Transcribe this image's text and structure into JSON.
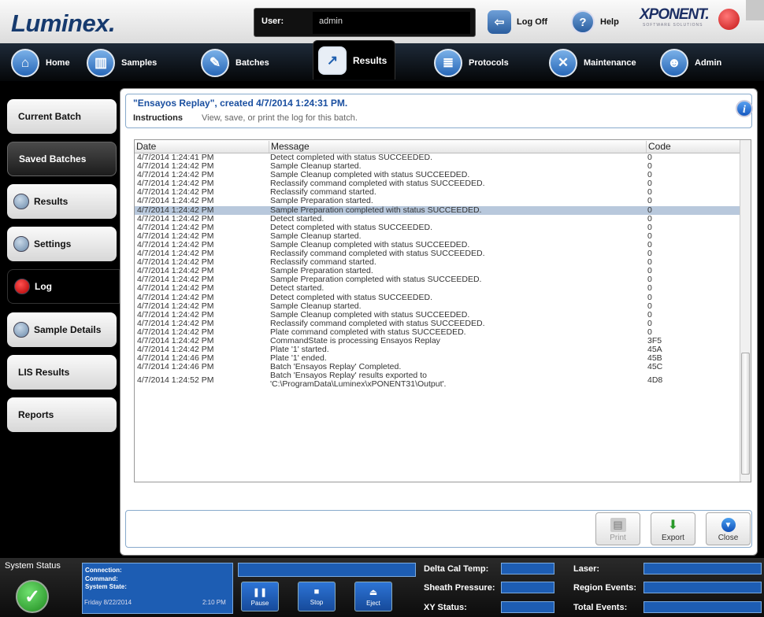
{
  "app": {
    "logo": "Luminex.",
    "brand": "XPONENT.",
    "brand_sub": "SOFTWARE SOLUTIONS"
  },
  "user": {
    "label": "User:",
    "value": "admin"
  },
  "topbar": {
    "logoff_label": "Log Off",
    "help_label": "Help"
  },
  "nav": {
    "tabs": [
      {
        "label": "Home",
        "icon": "home-icon"
      },
      {
        "label": "Samples",
        "icon": "samples-icon"
      },
      {
        "label": "Batches",
        "icon": "batches-icon"
      },
      {
        "label": "Results",
        "icon": "results-chart-icon",
        "active": true
      },
      {
        "label": "Protocols",
        "icon": "protocols-icon"
      },
      {
        "label": "Maintenance",
        "icon": "maintenance-icon"
      },
      {
        "label": "Admin",
        "icon": "admin-icon"
      }
    ]
  },
  "sidebar": {
    "items": [
      {
        "label": "Current Batch"
      },
      {
        "label": "Saved Batches"
      },
      {
        "label": "Results"
      },
      {
        "label": "Settings"
      },
      {
        "label": "Log"
      },
      {
        "label": "Sample Details"
      },
      {
        "label": "LIS Results"
      },
      {
        "label": "Reports"
      }
    ]
  },
  "header": {
    "title": "\"Ensayos Replay\", created 4/7/2014 1:24:31 PM.",
    "instructions_label": "Instructions",
    "instructions_text": "View, save, or print the log for this batch."
  },
  "log": {
    "columns": [
      "Date",
      "Message",
      "Code"
    ],
    "selected_index": 6,
    "rows": [
      [
        "4/7/2014 1:24:41 PM",
        "Detect completed with status SUCCEEDED.",
        "0"
      ],
      [
        "4/7/2014 1:24:42 PM",
        "Sample Cleanup started.",
        "0"
      ],
      [
        "4/7/2014 1:24:42 PM",
        "Sample Cleanup completed with status SUCCEEDED.",
        "0"
      ],
      [
        "4/7/2014 1:24:42 PM",
        "Reclassify command completed with status SUCCEEDED.",
        "0"
      ],
      [
        "4/7/2014 1:24:42 PM",
        "Reclassify command started.",
        "0"
      ],
      [
        "4/7/2014 1:24:42 PM",
        "Sample Preparation started.",
        "0"
      ],
      [
        "4/7/2014 1:24:42 PM",
        "Sample Preparation completed with status SUCCEEDED.",
        "0"
      ],
      [
        "4/7/2014 1:24:42 PM",
        "Detect started.",
        "0"
      ],
      [
        "4/7/2014 1:24:42 PM",
        "Detect completed with status SUCCEEDED.",
        "0"
      ],
      [
        "4/7/2014 1:24:42 PM",
        "Sample Cleanup started.",
        "0"
      ],
      [
        "4/7/2014 1:24:42 PM",
        "Sample Cleanup completed with status SUCCEEDED.",
        "0"
      ],
      [
        "4/7/2014 1:24:42 PM",
        "Reclassify command completed with status SUCCEEDED.",
        "0"
      ],
      [
        "4/7/2014 1:24:42 PM",
        "Reclassify command started.",
        "0"
      ],
      [
        "4/7/2014 1:24:42 PM",
        "Sample Preparation started.",
        "0"
      ],
      [
        "4/7/2014 1:24:42 PM",
        "Sample Preparation completed with status SUCCEEDED.",
        "0"
      ],
      [
        "4/7/2014 1:24:42 PM",
        "Detect started.",
        "0"
      ],
      [
        "4/7/2014 1:24:42 PM",
        "Detect completed with status SUCCEEDED.",
        "0"
      ],
      [
        "4/7/2014 1:24:42 PM",
        "Sample Cleanup started.",
        "0"
      ],
      [
        "4/7/2014 1:24:42 PM",
        "Sample Cleanup completed with status SUCCEEDED.",
        "0"
      ],
      [
        "4/7/2014 1:24:42 PM",
        "Reclassify command completed with status SUCCEEDED.",
        "0"
      ],
      [
        "4/7/2014 1:24:42 PM",
        "Plate command completed with status SUCCEEDED.",
        "0"
      ],
      [
        "4/7/2014 1:24:42 PM",
        "CommandState is processing Ensayos Replay",
        "3F5"
      ],
      [
        "4/7/2014 1:24:42 PM",
        "Plate '1' started.",
        "45A"
      ],
      [
        "4/7/2014 1:24:46 PM",
        "Plate '1' ended.",
        "45B"
      ],
      [
        "4/7/2014 1:24:46 PM",
        "Batch 'Ensayos Replay' Completed.",
        "45C"
      ],
      [
        "4/7/2014 1:24:52 PM",
        "Batch 'Ensayos Replay' results exported to 'C:\\ProgramData\\Luminex\\xPONENT31\\Output'.",
        "4D8"
      ]
    ]
  },
  "footer": {
    "print_label": "Print",
    "export_label": "Export",
    "close_label": "Close"
  },
  "status": {
    "title": "System Status",
    "connection_label": "Connection:",
    "command_label": "Command:",
    "system_state_label": "System State:",
    "date": "Friday 8/22/2014",
    "time": "2:10 PM",
    "pause_label": "Pause",
    "stop_label": "Stop",
    "eject_label": "Eject",
    "delta_cal_temp_label": "Delta Cal Temp:",
    "sheath_pressure_label": "Sheath Pressure:",
    "xy_status_label": "XY Status:",
    "laser_label": "Laser:",
    "region_events_label": "Region Events:",
    "total_events_label": "Total Events:"
  },
  "colors": {
    "accent_blue": "#1d5db3",
    "title_blue": "#1a4fa0",
    "selected_row": "#b8c8dc",
    "status_ok": "#2aa12a",
    "log_led": "#d00000"
  }
}
